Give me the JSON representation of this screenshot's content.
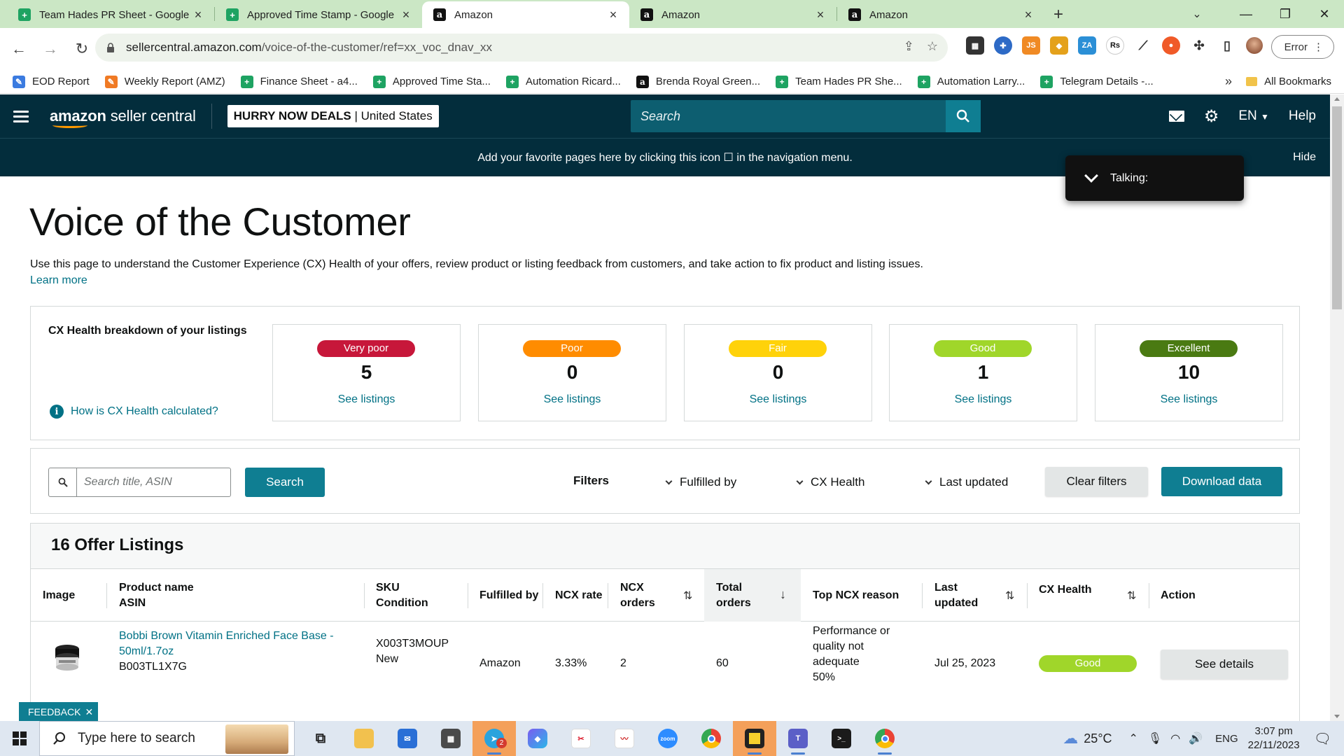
{
  "browser": {
    "tabs": [
      {
        "title": "Team Hades PR Sheet - Google S",
        "icon": "sheets-icon",
        "active": false
      },
      {
        "title": "Approved Time Stamp - Google",
        "icon": "sheets-icon",
        "active": false
      },
      {
        "title": "Amazon",
        "icon": "amazon-icon",
        "active": true
      },
      {
        "title": "Amazon",
        "icon": "amazon-icon",
        "active": false
      },
      {
        "title": "Amazon",
        "icon": "amazon-icon",
        "active": false
      }
    ],
    "url_host": "sellercentral.amazon.com",
    "url_path": "/voice-of-the-customer/ref=xx_voc_dnav_xx",
    "profile_status": "Error",
    "bookmarks": [
      {
        "label": "EOD Report",
        "icon": "pen-icon"
      },
      {
        "label": "Weekly Report (AMZ)",
        "icon": "pen-icon"
      },
      {
        "label": "Finance Sheet - a4...",
        "icon": "sheets-icon"
      },
      {
        "label": "Approved Time Sta...",
        "icon": "sheets-icon"
      },
      {
        "label": "Automation Ricard...",
        "icon": "sheets-icon"
      },
      {
        "label": "Brenda Royal Green...",
        "icon": "amazon-icon"
      },
      {
        "label": "Team Hades PR She...",
        "icon": "sheets-icon"
      },
      {
        "label": "Automation Larry...",
        "icon": "sheets-icon"
      },
      {
        "label": "Telegram Details -...",
        "icon": "sheets-icon"
      }
    ],
    "bookmarks_more": "»",
    "all_bookmarks": "All Bookmarks"
  },
  "header": {
    "logo_bold": "amazon",
    "logo_rest": "seller central",
    "store_name": "HURRY NOW DEALS",
    "store_region": "| United States",
    "search_placeholder": "Search",
    "language": "EN",
    "help": "Help"
  },
  "fav_banner": {
    "text": "Add your favorite pages here by clicking this icon ☐ in the navigation menu.",
    "hide": "Hide"
  },
  "talking_popup": "Talking:",
  "page": {
    "title": "Voice of the Customer",
    "description": "Use this page to understand the Customer Experience (CX) Health of your offers, review product or listing feedback from customers, and take action to fix product and listing issues.",
    "learn_more": "Learn more"
  },
  "cx_health": {
    "title": "CX Health breakdown of your listings",
    "how_link": "How is CX Health calculated?",
    "cards": [
      {
        "label": "Very poor",
        "count": "5",
        "link": "See listings",
        "color": "#c7173a",
        "text_color": "#ffffff"
      },
      {
        "label": "Poor",
        "count": "0",
        "link": "See listings",
        "color": "#ff8c00",
        "text_color": "#ffffff"
      },
      {
        "label": "Fair",
        "count": "0",
        "link": "See listings",
        "color": "#ffd20a",
        "text_color": "#ffffff"
      },
      {
        "label": "Good",
        "count": "1",
        "link": "See listings",
        "color": "#a0d62a",
        "text_color": "#ffffff"
      },
      {
        "label": "Excellent",
        "count": "10",
        "link": "See listings",
        "color": "#4a7a12",
        "text_color": "#ffffff"
      }
    ]
  },
  "filters": {
    "search_placeholder": "Search title, ASIN",
    "search_button": "Search",
    "filters_label": "Filters",
    "dropdowns": [
      "Fulfilled by",
      "CX Health",
      "Last updated"
    ],
    "clear_button": "Clear filters",
    "download_button": "Download data"
  },
  "listings": {
    "title": "16 Offer Listings",
    "columns": {
      "image": "Image",
      "product_name": "Product name",
      "asin": "ASIN",
      "sku": "SKU",
      "condition": "Condition",
      "fulfilled_by": "Fulfilled by",
      "ncx_rate": "NCX rate",
      "ncx_orders_1": "NCX",
      "ncx_orders_2": "orders",
      "total_orders_1": "Total",
      "total_orders_2": "orders",
      "top_ncx_reason": "Top NCX reason",
      "last_updated_1": "Last",
      "last_updated_2": "updated",
      "cx_health": "CX Health",
      "action": "Action"
    },
    "rows": [
      {
        "product_name_1": "Bobbi Brown Vitamin Enriched Face Base -",
        "product_name_2": "50ml/1.7oz",
        "asin": "B003TL1X7G",
        "sku": "X003T3MOUP",
        "condition": "New",
        "fulfilled_by": "Amazon",
        "ncx_rate": "3.33%",
        "ncx_orders": "2",
        "total_orders": "60",
        "reason_1": "Performance or",
        "reason_2": "quality not",
        "reason_3": "adequate",
        "reason_pct": "50%",
        "last_updated": "Jul 25, 2023",
        "cx_health": "Good",
        "action": "See details"
      }
    ]
  },
  "feedback_tab": "FEEDBACK",
  "taskbar": {
    "search_placeholder": "Type here to search",
    "weather": "25°C",
    "language": "ENG",
    "time": "3:07 pm",
    "date": "22/11/2023",
    "notification_badge": "2"
  }
}
